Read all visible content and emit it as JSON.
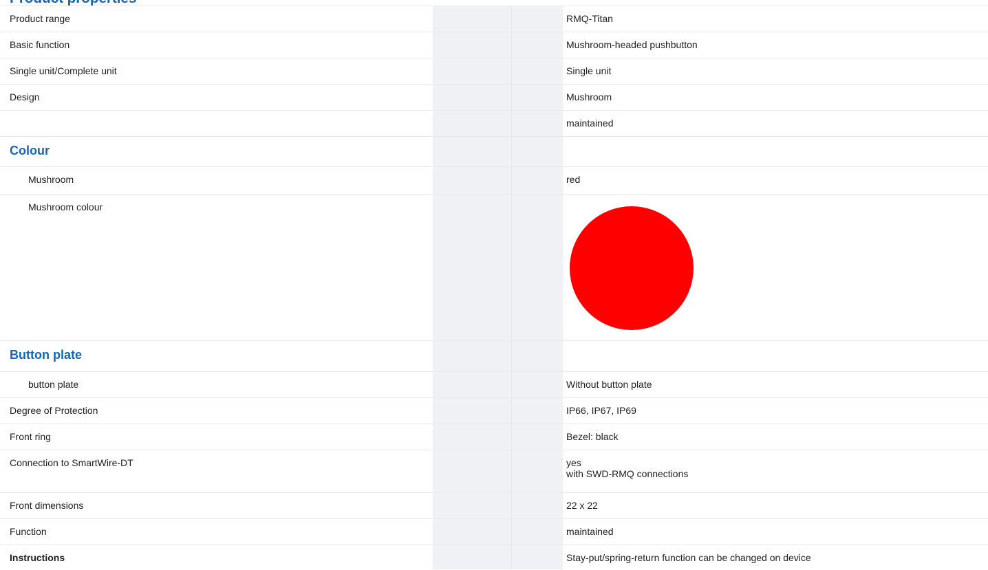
{
  "top_heading": "Product properties",
  "rows": [
    {
      "label": "Product range",
      "value": "RMQ-Titan"
    },
    {
      "label": "Basic function",
      "value": "Mushroom-headed pushbutton"
    },
    {
      "label": "Single unit/Complete unit",
      "value": "Single unit"
    },
    {
      "label": "Design",
      "value": "Mushroom"
    },
    {
      "label": "",
      "value": "maintained"
    }
  ],
  "colour_section": {
    "heading": "Colour",
    "mushroom_label": "Mushroom",
    "mushroom_value": "red",
    "mushroom_colour_label": "Mushroom colour",
    "swatch_color": "#ff0000"
  },
  "button_plate_section": {
    "heading": "Button plate",
    "label": "button plate",
    "value": "Without button plate"
  },
  "rows2": [
    {
      "label": "Degree of Protection",
      "value": "IP66, IP67, IP69"
    },
    {
      "label": "Front ring",
      "value": "Bezel: black"
    },
    {
      "label": "Connection to SmartWire-DT",
      "value": "yes",
      "value2": "with SWD-RMQ connections"
    },
    {
      "label": "Front dimensions",
      "value": "22 x 22"
    },
    {
      "label": "Function",
      "value": "maintained"
    },
    {
      "label": "Instructions",
      "value": "Stay-put/spring-return function can be changed on device"
    }
  ]
}
